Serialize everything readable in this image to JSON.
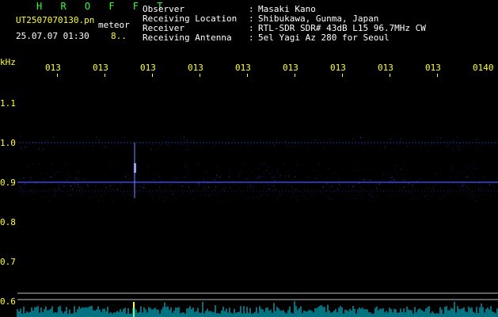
{
  "header": {
    "app_title": "H R O F F T",
    "filename": "UT2507070130.pn",
    "filename_suffix": "meteor",
    "datetime": "25.07.07 01:30",
    "count": "8..",
    "info": [
      {
        "label": "Observer",
        "value": "Masaki Kano"
      },
      {
        "label": "Receiving Location",
        "value": "Shibukawa, Gunma, Japan"
      },
      {
        "label": "Receiver",
        "value": "RTL-SDR SDR# 43dB L15 96.7MHz CW"
      },
      {
        "label": "Receiving Antenna",
        "value": "5el Yagi Az 280 for Seoul"
      }
    ],
    "separator": ":"
  },
  "axes": {
    "y_unit": "kHz",
    "x_ticks": [
      "013",
      "013",
      "013",
      "013",
      "013",
      "013",
      "013",
      "013",
      "013",
      "0140"
    ],
    "y_ticks": [
      "1.1",
      "1.0",
      "0.9",
      "0.8",
      "0.7",
      "0.6"
    ]
  },
  "colors": {
    "background": "#000000",
    "title": "#33ff33",
    "axis_text": "#ffff33",
    "info_text": "#ffffff",
    "signal": "#3a4dff",
    "signal_bright": "#9fb0ff",
    "level_trace": "#00e5ff",
    "grid_line": "#bdbdbd"
  }
}
